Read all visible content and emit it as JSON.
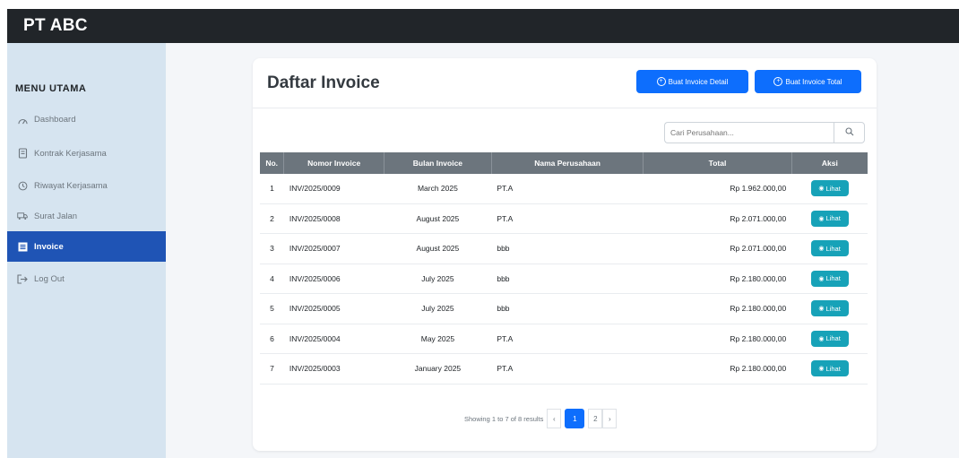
{
  "app": {
    "brand": "PT ABC"
  },
  "sidebar": {
    "title": "MENU UTAMA",
    "items": [
      {
        "label": "Dashboard",
        "icon": "dashboard-icon",
        "active": false
      },
      {
        "label": "Kontrak Kerjasama",
        "icon": "document-icon",
        "active": false
      },
      {
        "label": "Riwayat Kerjasama",
        "icon": "history-icon",
        "active": false
      },
      {
        "label": "Surat Jalan",
        "icon": "truck-icon",
        "active": false
      },
      {
        "label": "Invoice",
        "icon": "invoice-icon",
        "active": true
      },
      {
        "label": "Log Out",
        "icon": "logout-icon",
        "active": false
      }
    ]
  },
  "main": {
    "title": "Daftar Invoice",
    "buttons": {
      "detail": "Buat Invoice Detail",
      "total": "Buat Invoice Total"
    },
    "search": {
      "placeholder": "Cari Perusahaan..."
    },
    "table": {
      "headers": [
        "No.",
        "Nomor Invoice",
        "Bulan Invoice",
        "Nama Perusahaan",
        "Total",
        "Aksi"
      ],
      "rows": [
        {
          "no": "1",
          "nomor": "INV/2025/0009",
          "bulan": "March 2025",
          "nama": "PT.A",
          "total": "Rp 1.962.000,00",
          "aksi": "Lihat"
        },
        {
          "no": "2",
          "nomor": "INV/2025/0008",
          "bulan": "August 2025",
          "nama": "PT.A",
          "total": "Rp 2.071.000,00",
          "aksi": "Lihat"
        },
        {
          "no": "3",
          "nomor": "INV/2025/0007",
          "bulan": "August 2025",
          "nama": "bbb",
          "total": "Rp 2.071.000,00",
          "aksi": "Lihat"
        },
        {
          "no": "4",
          "nomor": "INV/2025/0006",
          "bulan": "July 2025",
          "nama": "bbb",
          "total": "Rp 2.180.000,00",
          "aksi": "Lihat"
        },
        {
          "no": "5",
          "nomor": "INV/2025/0005",
          "bulan": "July 2025",
          "nama": "bbb",
          "total": "Rp 2.180.000,00",
          "aksi": "Lihat"
        },
        {
          "no": "6",
          "nomor": "INV/2025/0004",
          "bulan": "May 2025",
          "nama": "PT.A",
          "total": "Rp 2.180.000,00",
          "aksi": "Lihat"
        },
        {
          "no": "7",
          "nomor": "INV/2025/0003",
          "bulan": "January 2025",
          "nama": "PT.A",
          "total": "Rp 2.180.000,00",
          "aksi": "Lihat"
        }
      ]
    },
    "pagination": {
      "info": "Showing 1 to 7 of 8 results",
      "prev": "‹",
      "pages": [
        "1",
        "2"
      ],
      "current": "1",
      "next": "›"
    }
  },
  "colors": {
    "topbar": "#212529",
    "sidebar": "#d6e4f0",
    "sidebar_active": "#1f54b5",
    "primary": "#0d6efd",
    "info": "#17a2b8",
    "table_header": "#6c757d"
  }
}
